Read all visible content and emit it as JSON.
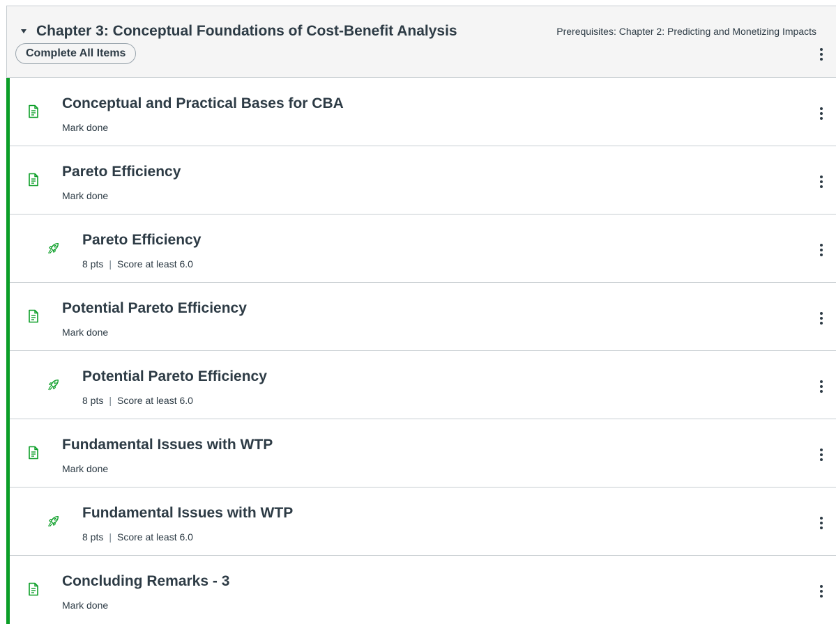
{
  "module": {
    "title": "Chapter 3: Conceptual Foundations of Cost-Benefit Analysis",
    "prerequisites": "Prerequisites: Chapter 2: Predicting and Monetizing Impacts",
    "complete_all_label": "Complete All Items",
    "accent_color": "#0b9e27"
  },
  "items": [
    {
      "type": "page",
      "icon": "page-icon",
      "title": "Conceptual and Practical Bases for CBA",
      "status": "Mark done"
    },
    {
      "type": "page",
      "icon": "page-icon",
      "title": "Pareto Efficiency",
      "status": "Mark done"
    },
    {
      "type": "quiz",
      "icon": "quiz-rocket-icon",
      "title": "Pareto Efficiency",
      "points": "8 pts",
      "separator": "|",
      "requirement": "Score at least 6.0"
    },
    {
      "type": "page",
      "icon": "page-icon",
      "title": "Potential Pareto Efficiency",
      "status": "Mark done"
    },
    {
      "type": "quiz",
      "icon": "quiz-rocket-icon",
      "title": "Potential Pareto Efficiency",
      "points": "8 pts",
      "separator": "|",
      "requirement": "Score at least 6.0"
    },
    {
      "type": "page",
      "icon": "page-icon",
      "title": "Fundamental Issues with WTP",
      "status": "Mark done"
    },
    {
      "type": "quiz",
      "icon": "quiz-rocket-icon",
      "title": "Fundamental Issues with WTP",
      "points": "8 pts",
      "separator": "|",
      "requirement": "Score at least 6.0"
    },
    {
      "type": "page",
      "icon": "page-icon",
      "title": "Concluding Remarks - 3",
      "status": "Mark done"
    }
  ]
}
